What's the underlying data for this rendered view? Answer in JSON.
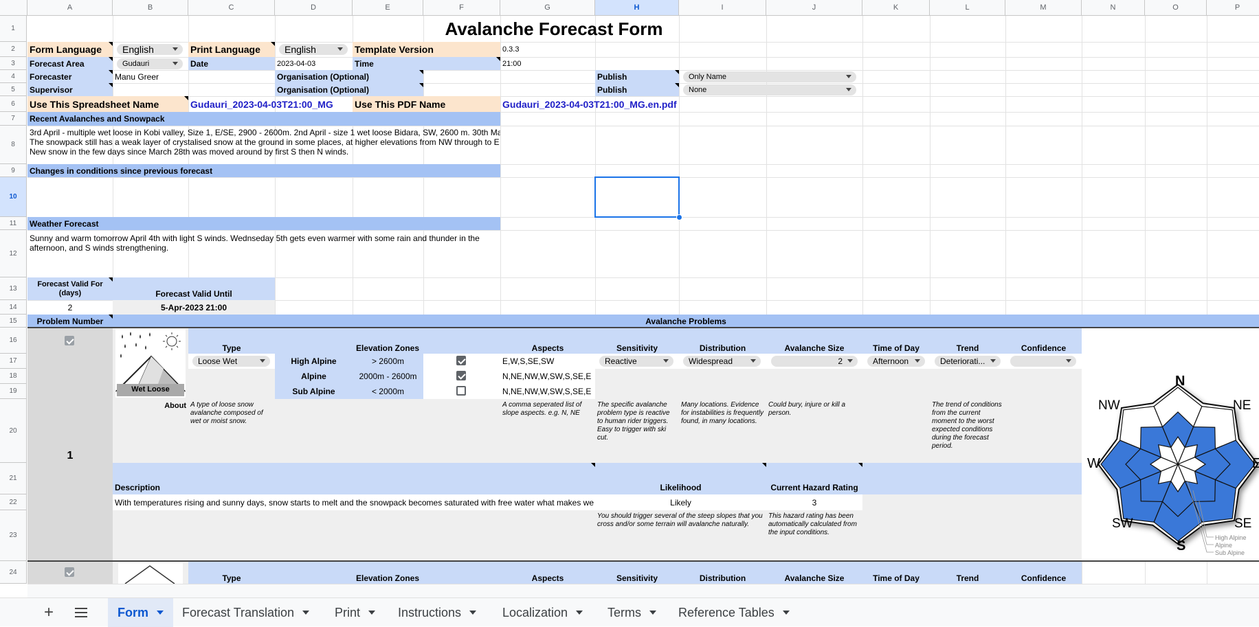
{
  "column_headers": [
    "A",
    "B",
    "C",
    "D",
    "E",
    "F",
    "G",
    "H",
    "I",
    "J",
    "K",
    "L",
    "M",
    "N",
    "O",
    "P"
  ],
  "row_headers": [
    "1",
    "2",
    "3",
    "4",
    "5",
    "6",
    "7",
    "8",
    "9",
    "10",
    "11",
    "12",
    "13",
    "14",
    "15",
    "16",
    "17",
    "18",
    "19",
    "20",
    "21",
    "22",
    "23",
    "24"
  ],
  "title": "Avalanche Forecast Form",
  "labels": {
    "form_language": "Form Language",
    "print_language": "Print Language",
    "template_version": "Template Version",
    "forecast_area": "Forecast Area",
    "date": "Date",
    "time": "Time",
    "forecaster": "Forecaster",
    "supervisor": "Supervisor",
    "organisation_optional": "Organisation (Optional)",
    "publish": "Publish",
    "use_spreadsheet_name": "Use This Spreadsheet Name",
    "use_pdf_name": "Use This PDF Name",
    "recent_avalanches": "Recent Avalanches and Snowpack",
    "changes": "Changes in conditions since previous forecast",
    "weather_forecast": "Weather Forecast",
    "forecast_valid_for": "Forecast Valid For (days)",
    "forecast_valid_until": "Forecast Valid Until",
    "problem_number": "Problem Number",
    "avalanche_problems": "Avalanche Problems"
  },
  "values": {
    "form_language": "English",
    "print_language": "English",
    "template_version": "0.3.3",
    "forecast_area": "Gudauri",
    "date": "2023-04-03",
    "time": "21:00",
    "forecaster": "Manu Greer",
    "publish_1": "Only Name",
    "publish_2": "None",
    "spreadsheet_name": "Gudauri_2023-04-03T21:00_MG",
    "pdf_name": "Gudauri_2023-04-03T21:00_MG.en.pdf",
    "recent_line1": "3rd April - multiple wet loose in Kobi valley, Size 1, E/SE, 2900 - 2600m. 2nd April - size 1 wet loose Bidara, SW, 2600 m. 30th Ma",
    "recent_line2": "The snowpack still has a weak layer of crystalised snow at the ground in some places, at higher elevations from NW through to E",
    "recent_line3": "New snow in the few days since March 28th was moved around by first S then N winds.",
    "weather_text": "Sunny and warm tomorrow April 4th with light S winds. Wednseday 5th gets even warmer with some rain and thunder in the afternoon, and S winds strengthening.",
    "valid_days": "2",
    "valid_until": "5-Apr-2023 21:00"
  },
  "problem_headers": {
    "type": "Type",
    "elevation_zones": "Elevation Zones",
    "aspects": "Aspects",
    "sensitivity": "Sensitivity",
    "distribution": "Distribution",
    "avalanche_size": "Avalanche Size",
    "time_of_day": "Time of Day",
    "trend": "Trend",
    "confidence": "Confidence",
    "about": "About",
    "description": "Description",
    "likelihood": "Likelihood",
    "current_hazard_rating": "Current Hazard Rating"
  },
  "problem1": {
    "number": "1",
    "icon_label": "Wet Loose",
    "type": "Loose Wet",
    "sensitivity": "Reactive",
    "distribution": "Widespread",
    "avalanche_size": "2",
    "time_of_day": "Afternoon",
    "trend": "Deteriorati...",
    "confidence": "",
    "zones": [
      {
        "name": "High Alpine",
        "range": "> 2600m",
        "checked": true,
        "aspects": "E,W,S,SE,SW"
      },
      {
        "name": "Alpine",
        "range": "2000m - 2600m",
        "checked": true,
        "aspects": "N,NE,NW,W,SW,S,SE,E"
      },
      {
        "name": "Sub Alpine",
        "range": "< 2000m",
        "checked": false,
        "aspects": "N,NE,NW,W,SW,S,SE,E"
      }
    ],
    "about_type": "A type of loose snow avalanche composed of wet or moist snow.",
    "about_aspects": "A comma seperated list of slope aspects. e.g. N, NE",
    "about_sensitivity": "The specific avalanche problem type is reactive to human rider triggers. Easy to trigger with ski cut.",
    "about_distribution": "Many locations. Evidence for instabilities is frequently found, in many locations.",
    "about_size": "Could bury, injure or kill a person.",
    "about_trend": "The trend of conditions from the current moment to the worst expected conditions during the forecast period.",
    "description_text": "With temperatures rising and sunny days, snow starts to melt and the snowpack becomes saturated with free water what makes we",
    "likelihood": "Likely",
    "hazard_rating": "3",
    "likelihood_note": "You should trigger several of the steep slopes that you cross and/or some terrain will avalanche naturally.",
    "hazard_note": "This hazard rating has been automatically calculated from the input conditions."
  },
  "rose": {
    "directions": [
      "N",
      "NE",
      "E",
      "SE",
      "S",
      "SW",
      "W",
      "NW"
    ],
    "legend": [
      "High Alpine",
      "Alpine",
      "Sub Alpine"
    ],
    "fill_color": "#3a78d8",
    "high_alpine_filled": [
      "E",
      "SE",
      "S",
      "SW",
      "W"
    ],
    "alpine_filled": [
      "N",
      "NE",
      "E",
      "SE",
      "S",
      "SW",
      "W",
      "NW"
    ],
    "sub_alpine_filled": []
  },
  "tabs": [
    "Form",
    "Forecast Translation",
    "Print",
    "Instructions",
    "Localization",
    "Terms",
    "Reference Tables"
  ],
  "active_tab": "Form"
}
